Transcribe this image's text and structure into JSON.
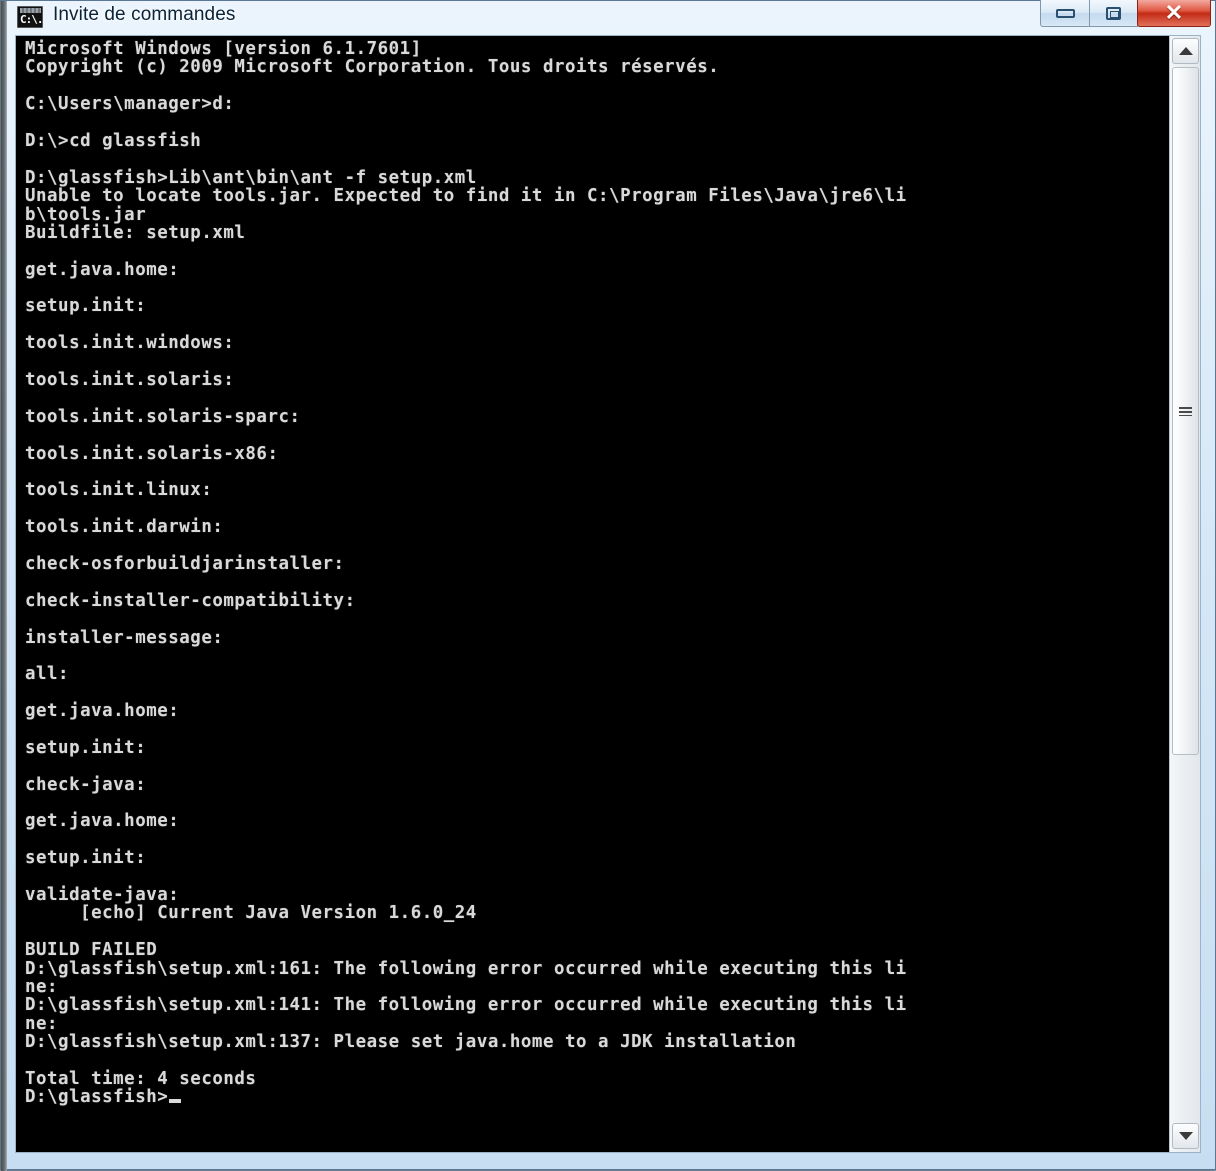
{
  "window": {
    "title": "Invite de commandes",
    "icon": "cmd-console-icon",
    "icon_glyph": "C:\\.",
    "buttons": {
      "minimize_label": "Minimize",
      "maximize_label": "Restore",
      "close_label": "✕"
    }
  },
  "scrollbar": {
    "up_label": "Scroll up",
    "down_label": "Scroll down",
    "thumb_label": "Scroll thumb"
  },
  "console": {
    "background": "#000000",
    "foreground": "#d9d9d9",
    "cursor": "_",
    "lines": [
      "Microsoft Windows [version 6.1.7601]",
      "Copyright (c) 2009 Microsoft Corporation. Tous droits réservés.",
      "",
      "C:\\Users\\manager>d:",
      "",
      "D:\\>cd glassfish",
      "",
      "D:\\glassfish>Lib\\ant\\bin\\ant -f setup.xml",
      "Unable to locate tools.jar. Expected to find it in C:\\Program Files\\Java\\jre6\\li",
      "b\\tools.jar",
      "Buildfile: setup.xml",
      "",
      "get.java.home:",
      "",
      "setup.init:",
      "",
      "tools.init.windows:",
      "",
      "tools.init.solaris:",
      "",
      "tools.init.solaris-sparc:",
      "",
      "tools.init.solaris-x86:",
      "",
      "tools.init.linux:",
      "",
      "tools.init.darwin:",
      "",
      "check-osforbuildjarinstaller:",
      "",
      "check-installer-compatibility:",
      "",
      "installer-message:",
      "",
      "all:",
      "",
      "get.java.home:",
      "",
      "setup.init:",
      "",
      "check-java:",
      "",
      "get.java.home:",
      "",
      "setup.init:",
      "",
      "validate-java:",
      "     [echo] Current Java Version 1.6.0_24",
      "",
      "BUILD FAILED",
      "D:\\glassfish\\setup.xml:161: The following error occurred while executing this li",
      "ne:",
      "D:\\glassfish\\setup.xml:141: The following error occurred while executing this li",
      "ne:",
      "D:\\glassfish\\setup.xml:137: Please set java.home to a JDK installation",
      "",
      "Total time: 4 seconds"
    ],
    "prompt": "D:\\glassfish>"
  }
}
